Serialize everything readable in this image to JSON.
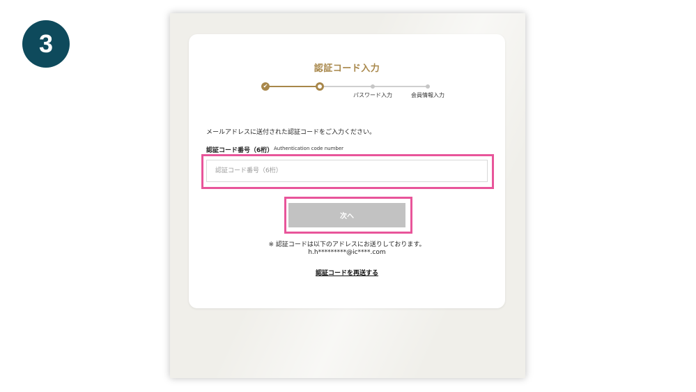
{
  "step_number": "3",
  "card": {
    "title": "認証コード入力",
    "stepper": {
      "steps": [
        {
          "label": "",
          "state": "done",
          "icon": "check-icon"
        },
        {
          "label": "",
          "state": "current"
        },
        {
          "label": "パスワード入力",
          "state": "todo"
        },
        {
          "label": "会員情報入力",
          "state": "todo"
        }
      ],
      "done_icon": "✔"
    },
    "instruction": "メールアドレスに送付された認証コードをご入力ください。",
    "field": {
      "label": "認証コード番号（6桁）",
      "sublabel": "Authentication code number",
      "placeholder": "認証コード番号（6桁）",
      "value": ""
    },
    "next_button_label": "次へ",
    "note": "※ 認証コードは以下のアドレスにお送りしております。",
    "email": "h.h*********@ic****.com",
    "resend_link": "認証コードを再送する"
  },
  "colors": {
    "badge": "#0e4a5c",
    "accent_gold": "#a8874a",
    "highlight_pink": "#e8559a",
    "button_disabled": "#c2c2c2",
    "frame_bg": "#f0efea"
  }
}
